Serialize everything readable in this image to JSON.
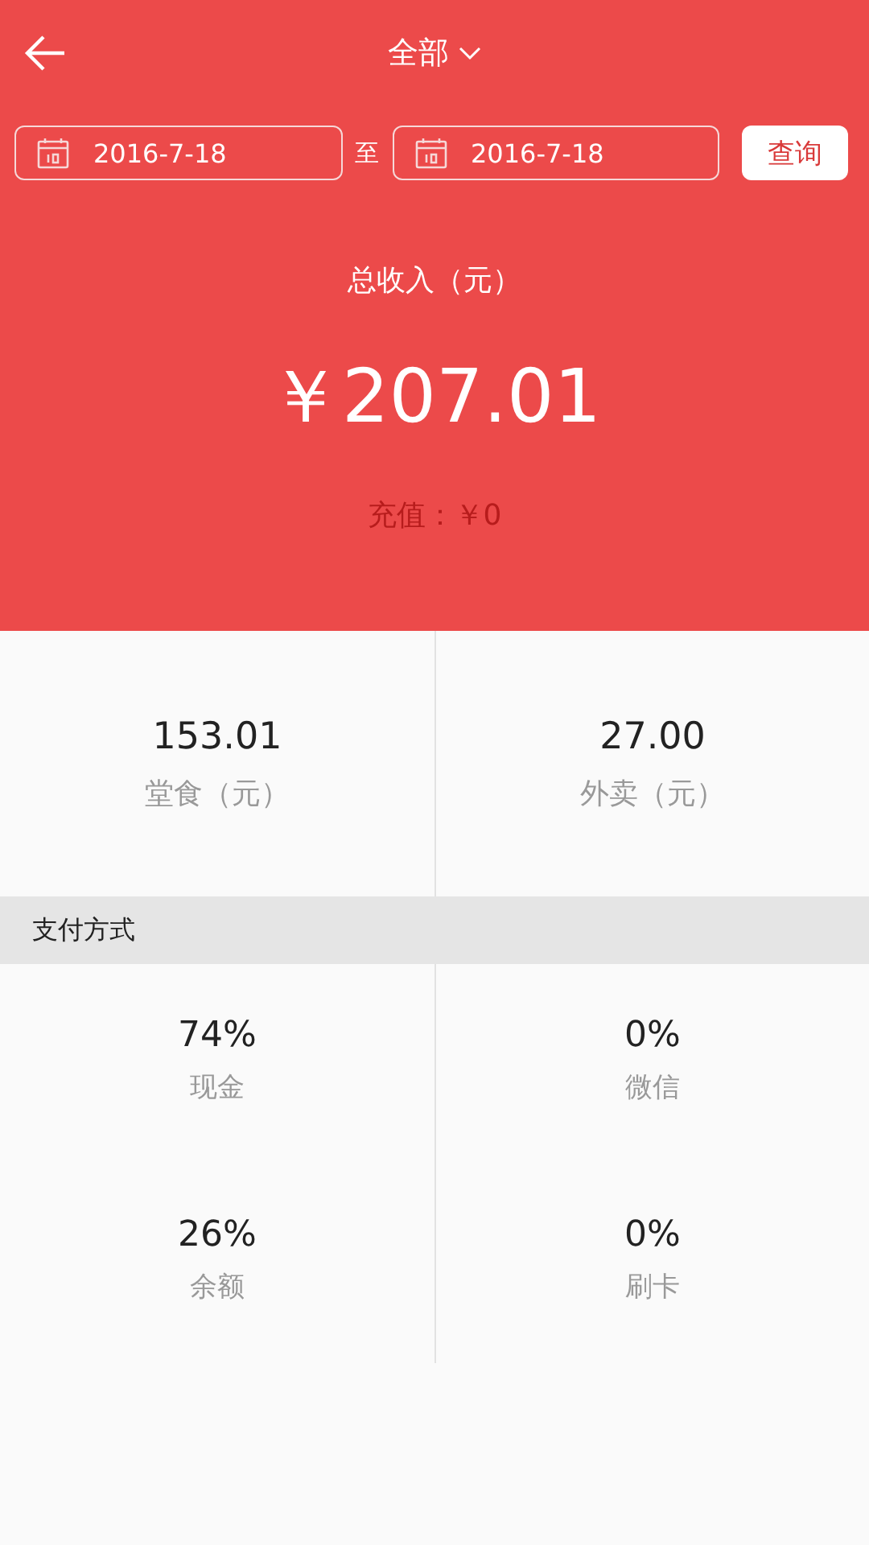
{
  "header": {
    "title": "全部"
  },
  "date_range": {
    "start": "2016-7-18",
    "separator": "至",
    "end": "2016-7-18",
    "query_button": "查询"
  },
  "summary": {
    "label": "总收入（元）",
    "amount": "￥207.01",
    "recharge": "充值：￥0"
  },
  "breakdown": [
    {
      "value": "153.01",
      "label": "堂食（元）"
    },
    {
      "value": "27.00",
      "label": "外卖（元）"
    }
  ],
  "payment": {
    "title": "支付方式",
    "items": [
      {
        "value": "74%",
        "label": "现金"
      },
      {
        "value": "0%",
        "label": "微信"
      },
      {
        "value": "26%",
        "label": "余额"
      },
      {
        "value": "0%",
        "label": "刷卡"
      }
    ]
  }
}
